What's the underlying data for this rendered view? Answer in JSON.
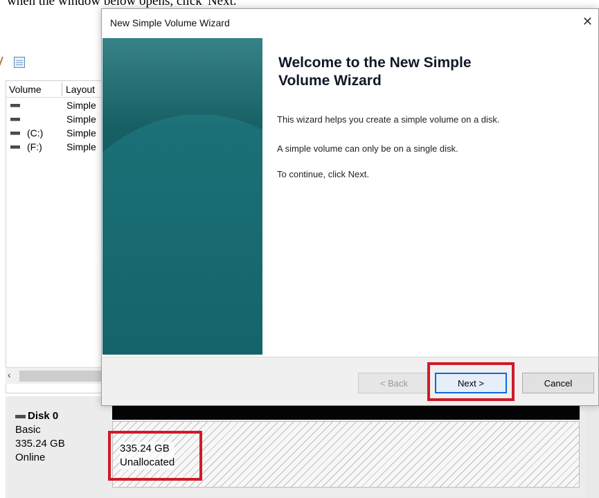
{
  "doc_caption": "when the window below opens, click 'Next.'",
  "disk_management": {
    "columns": [
      "Volume",
      "Layout"
    ],
    "volumes": [
      {
        "name": "",
        "layout": "Simple"
      },
      {
        "name": "",
        "layout": "Simple"
      },
      {
        "name": "(C:)",
        "layout": "Simple"
      },
      {
        "name": "(F:)",
        "layout": "Simple"
      }
    ],
    "disk": {
      "title": "Disk 0",
      "type": "Basic",
      "size": "335.24 GB",
      "status": "Online"
    },
    "partition": {
      "size": "335.24 GB",
      "label": "Unallocated"
    }
  },
  "wizard": {
    "title": "New Simple Volume Wizard",
    "close_glyph": "✕",
    "heading_line1": "Welcome to the New Simple",
    "heading_line2": "Volume Wizard",
    "body": [
      "This wizard helps you create a simple volume on a disk.",
      "A simple volume can only be on a single disk.",
      "To continue, click Next."
    ],
    "buttons": {
      "back": "< Back",
      "next": "Next >",
      "cancel": "Cancel"
    }
  },
  "colors": {
    "highlight": "#d01a27",
    "banner": "#155d62",
    "default_button_border": "#0a6ad4"
  }
}
